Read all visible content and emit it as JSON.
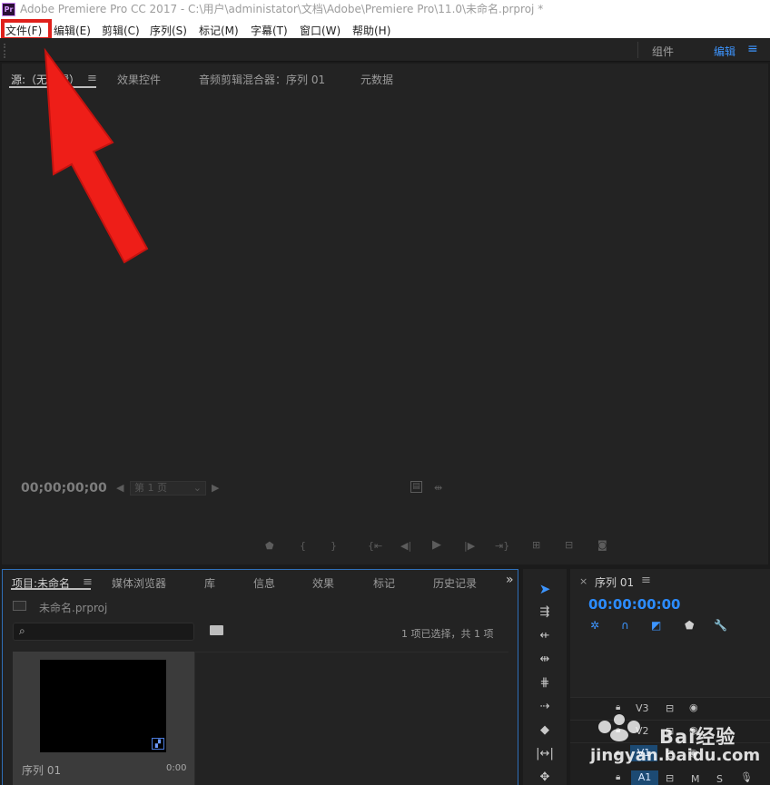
{
  "window": {
    "title": "Adobe Premiere Pro CC 2017 - C:\\用户\\administator\\文档\\Adobe\\Premiere Pro\\11.0\\未命名.prproj *",
    "logo_text": "Pr"
  },
  "menu": [
    "文件(F)",
    "编辑(E)",
    "剪辑(C)",
    "序列(S)",
    "标记(M)",
    "字幕(T)",
    "窗口(W)",
    "帮助(H)"
  ],
  "workspace": {
    "tab_assembly": "组件",
    "tab_editing": "编辑",
    "menu_icon": "≡"
  },
  "source_panel": {
    "tabs": [
      "源:（无剪辑）",
      "效果控件",
      "音频剪辑混合器：序列 01",
      "元数据"
    ],
    "menu_icon": "≡",
    "timecode": "00;00;00;00",
    "page_select": "第 1 页"
  },
  "project_panel": {
    "tabs": [
      "项目:未命名",
      "媒体浏览器",
      "库",
      "信息",
      "效果",
      "标记",
      "历史记录"
    ],
    "menu_icon": "≡",
    "overflow": "»",
    "file_name": "未命名.prproj",
    "selection_status": "1 项已选择，共 1 项",
    "item_name": "序列 01",
    "item_duration": "0:00"
  },
  "timeline": {
    "close": "×",
    "title": "序列 01",
    "menu_icon": "≡",
    "timecode": "00:00:00:00",
    "tracks": [
      "V3",
      "V2",
      "V1",
      "A1"
    ],
    "mute_label": "M",
    "solo_label": "S"
  },
  "watermark": {
    "brand": "Bai经验",
    "url": "jingyan.baidu.com"
  },
  "colors": {
    "accent": "#2c8cff",
    "highlight": "#e0201b",
    "panel_bg": "#232323"
  }
}
